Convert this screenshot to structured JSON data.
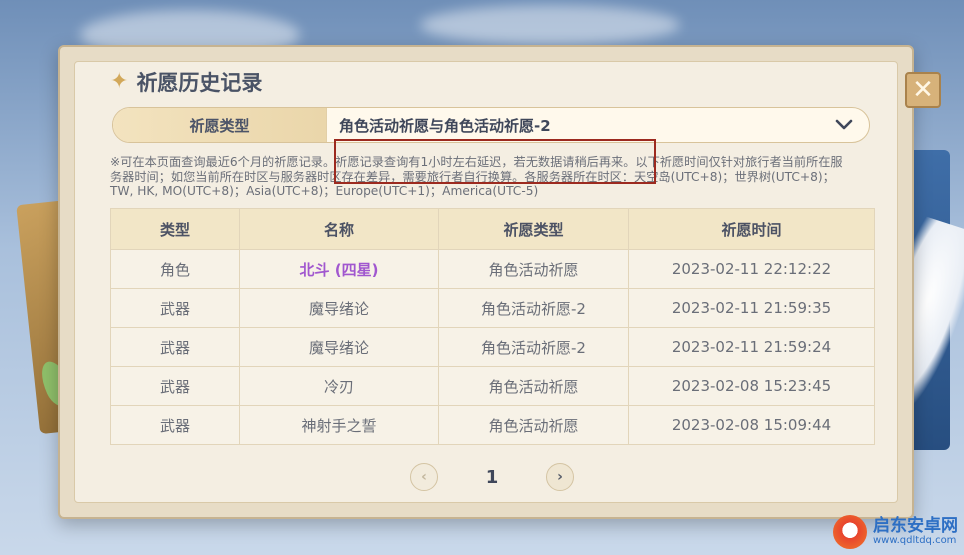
{
  "header": {
    "title": "祈愿历史记录",
    "close_label": "✕"
  },
  "filter": {
    "label": "祈愿类型",
    "value": "角色活动祈愿与角色活动祈愿-2"
  },
  "notice": {
    "line1": "※可在本页面查询最近6个月的祈愿记录。祈愿记录查询有1小时左右延迟，若无数据请稍后再来。以下祈愿时间仅针对旅行者当前所在服",
    "line2": "务器时间；如您当前所在时区与服务器时区存在差异，需要旅行者自行换算。各服务器所在时区：天空岛(UTC+8)；世界树(UTC+8)；",
    "line3": "TW, HK, MO(UTC+8)；Asia(UTC+8)；Europe(UTC+1)；America(UTC-5)"
  },
  "table": {
    "headers": [
      "类型",
      "名称",
      "祈愿类型",
      "祈愿时间"
    ],
    "rows": [
      {
        "type": "角色",
        "name": "北斗 (四星)",
        "wish": "角色活动祈愿",
        "time": "2023-02-11 22:12:22"
      },
      {
        "type": "武器",
        "name": "魔导绪论",
        "wish": "角色活动祈愿-2",
        "time": "2023-02-11 21:59:35"
      },
      {
        "type": "武器",
        "name": "魔导绪论",
        "wish": "角色活动祈愿-2",
        "time": "2023-02-11 21:59:24"
      },
      {
        "type": "武器",
        "name": "冷刃",
        "wish": "角色活动祈愿",
        "time": "2023-02-08 15:23:45"
      },
      {
        "type": "武器",
        "name": "神射手之誓",
        "wish": "角色活动祈愿",
        "time": "2023-02-08 15:09:44"
      }
    ]
  },
  "pagination": {
    "prev": "‹",
    "page": "1",
    "next": "›"
  },
  "watermark": {
    "name": "启东安卓网",
    "url": "www.qdltdq.com"
  },
  "colors": {
    "star4_name": "#a157cf",
    "highlight_box": "#9c2a1f",
    "header_bg": "#f2e6c7"
  }
}
